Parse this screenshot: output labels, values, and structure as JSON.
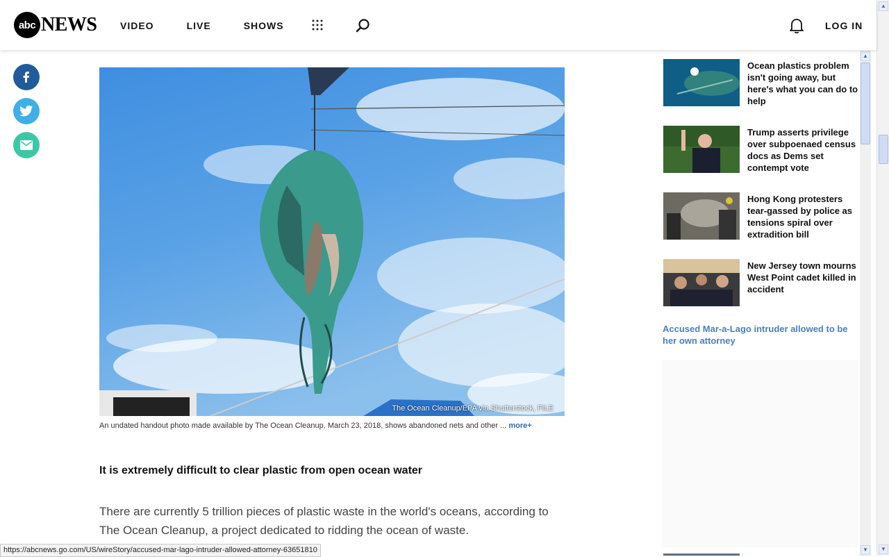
{
  "header": {
    "logo_abc": "abc",
    "logo_news": "NEWS",
    "nav": [
      "VIDEO",
      "LIVE",
      "SHOWS"
    ],
    "login": "LOG IN"
  },
  "article": {
    "photo_credit": "The Ocean Cleanup/EPA via Shutterstock, FILE",
    "caption": "An undated handout photo made available by The Ocean Cleanup, March 23, 2018, shows abandoned nets and other ...",
    "caption_more": "more+",
    "subhead": "It is extremely difficult to clear plastic from open ocean water",
    "body": "There are currently 5 trillion pieces of plastic waste in the world's oceans, according to The Ocean Cleanup, a project dedicated to ridding the ocean of waste."
  },
  "sidebar": {
    "stories": [
      {
        "title": "Ocean plastics problem isn't going away, but here's what you can do to help"
      },
      {
        "title": "Trump asserts privilege over subpoenaed census docs as Dems set contempt vote"
      },
      {
        "title": "Hong Kong protesters tear-gassed by police as tensions spiral over extradition bill"
      },
      {
        "title": "New Jersey town mourns West Point cadet killed in accident"
      }
    ],
    "related_link": "Accused Mar-a-Lago intruder allowed to be her own attorney"
  },
  "status_bar": {
    "url": "https://abcnews.go.com/US/wireStory/accused-mar-lago-intruder-allowed-attorney-63651810"
  },
  "colors": {
    "facebook": "#215b9c",
    "twitter": "#3eb0e6",
    "email": "#3dc8a5",
    "link": "#4a7fc1"
  }
}
